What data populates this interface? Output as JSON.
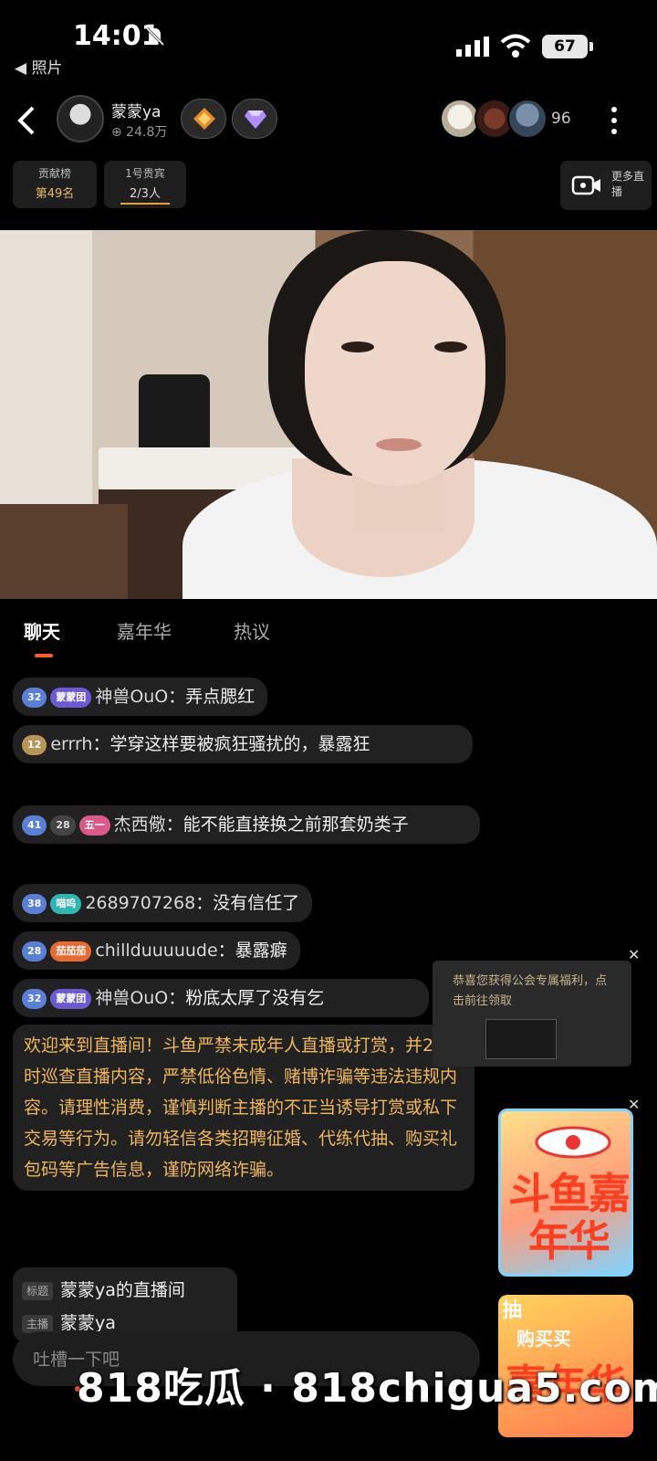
{
  "status_bar": {
    "time": "14:01",
    "battery": "67",
    "back_app": "◀ 照片"
  },
  "header": {
    "host_name": "蒙蒙ya",
    "host_fans": "⊕ 24.8万",
    "viewer_count": "96",
    "rank_buttons": [
      {
        "line1": "贡献榜",
        "line2": "第49名"
      },
      {
        "line1": "1号贵宾",
        "line2": "2/3人"
      }
    ],
    "more_live": "更多直播"
  },
  "tabs": [
    {
      "label": "聊天"
    },
    {
      "label": "嘉年华"
    },
    {
      "label": "热议"
    }
  ],
  "chat": {
    "messages": [
      {
        "level": "32",
        "fan_badge": "蒙蒙团",
        "user": "神兽OuO",
        "text": "：弄点腮红"
      },
      {
        "level": "12",
        "user": "errrh",
        "text": "：学穿这样要被疯狂骚扰的，暴露狂"
      },
      {
        "level": "41",
        "level_num": "28",
        "fan_badge": "五一",
        "user": "杰西儆",
        "text": "：能不能直接换之前那套奶类子"
      },
      {
        "level": "38",
        "fan_badge": "喵呜",
        "user": "2689707268",
        "text": "：没有信任了"
      },
      {
        "level": "28",
        "fan_badge": "茄茄茄",
        "user": "chillduuuuude",
        "text": "：暴露癖"
      },
      {
        "level": "32",
        "fan_badge": "蒙蒙团",
        "user": "神兽OuO",
        "text": "：粉底太厚了没有乞"
      }
    ],
    "system_message": "欢迎来到直播间！斗鱼严禁未成年人直播或打赏，并24小时巡查直播内容，严禁低俗色情、赌博诈骗等违法违规内容。请理性消费，谨慎判断主播的不正当诱导打赏或私下交易等行为。请勿轻信各类招聘征婚、代练代抽、购买礼包码等广告信息，谨防网络诈骗。",
    "room_info": {
      "title_tag": "标题",
      "title": "蒙蒙ya的直播间",
      "host_tag": "主播",
      "host": "蒙蒙ya"
    }
  },
  "promo": {
    "text": "恭喜您获得公会专属福利，点击前往领取"
  },
  "carnival": {
    "title": "斗鱼嘉年华",
    "card2_top": "抽",
    "card2_mid": "购买买",
    "card2_big": "嘉年华"
  },
  "input": {
    "placeholder": "吐槽一下吧"
  },
  "watermark": "818吃瓜 · 818chigua5.com",
  "icons": [
    "bell-off-icon",
    "signal-icon",
    "wifi-icon",
    "back-arrow-icon",
    "more-icon",
    "video-camera-icon",
    "close-icon"
  ]
}
